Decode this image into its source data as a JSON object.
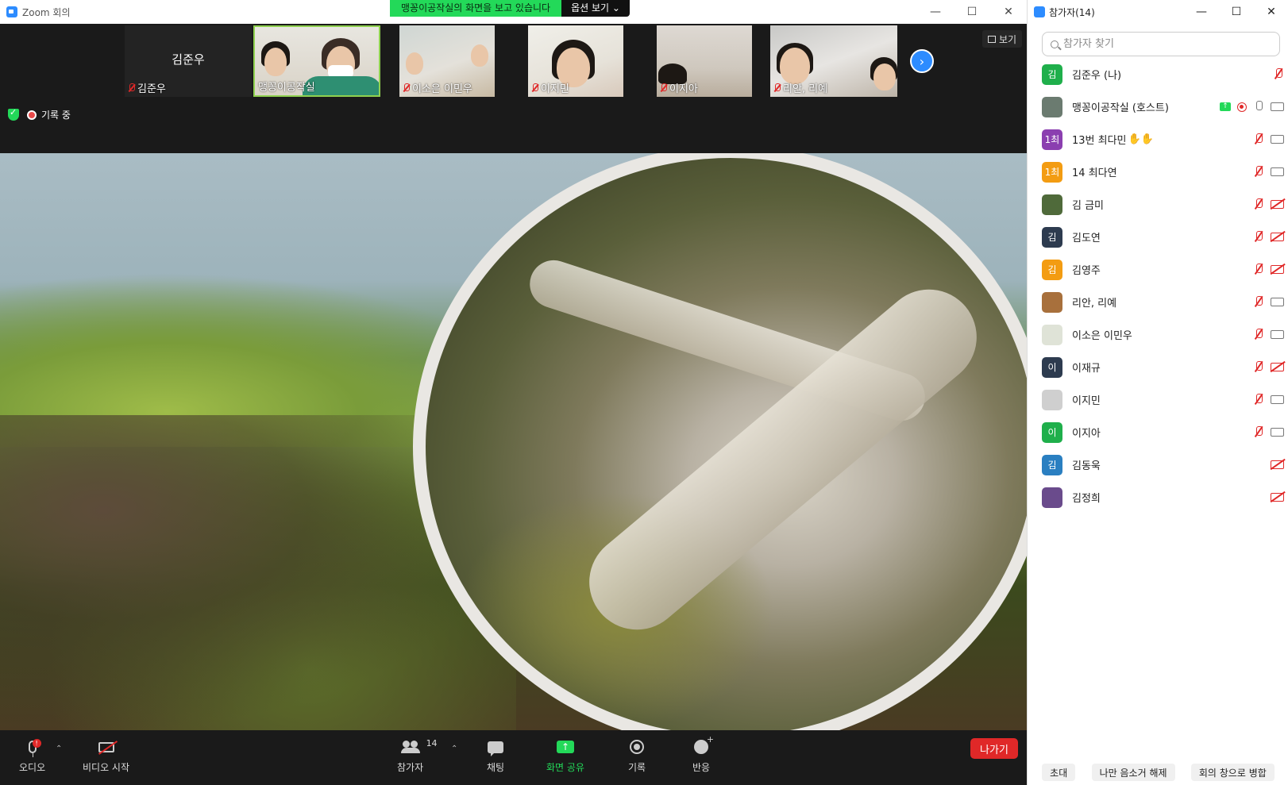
{
  "window": {
    "title": "Zoom 회의",
    "controls": [
      "—",
      "☐",
      "✕"
    ]
  },
  "share_banner": {
    "message": "맹꽁이공작실의 화면을 보고 있습니다",
    "options_label": "옵션 보기 ⌄"
  },
  "strip": {
    "view_label": "보기",
    "next_icon": "chevron-right-icon",
    "thumbnails": [
      {
        "name": "김준우",
        "big_name": "김준우",
        "muted": true,
        "video": false
      },
      {
        "name": "맹꽁이공작실",
        "muted": false,
        "video": true,
        "active_speaker": true
      },
      {
        "name": "이소은 이민우",
        "muted": true,
        "video": true
      },
      {
        "name": "이지민",
        "muted": true,
        "video": true
      },
      {
        "name": "이지아",
        "muted": true,
        "video": true
      },
      {
        "name": "리안, 리예",
        "muted": true,
        "video": true
      }
    ]
  },
  "status": {
    "encryption_icon": "shield-check-icon",
    "recording_label": "기록 중"
  },
  "toolbar": {
    "audio_label": "오디오",
    "video_label": "비디오 시작",
    "participants_label": "참가자",
    "participants_count": "14",
    "chat_label": "채팅",
    "share_label": "화면 공유",
    "record_label": "기록",
    "reactions_label": "반응",
    "leave_label": "나가기"
  },
  "panel": {
    "title": "참가자(14)",
    "controls": [
      "—",
      "☐",
      "✕"
    ],
    "search_placeholder": "참가자 찾기",
    "participants": [
      {
        "name": "김준우 (나)",
        "avatar": "김",
        "color": "#1faf4b",
        "mic": "off",
        "cam": "none"
      },
      {
        "name": "맹꽁이공작실 (호스트)",
        "avatar": "",
        "color": "#6b7b70",
        "mic": "on",
        "cam": "on",
        "sharing": true,
        "recording": true
      },
      {
        "name": "13번 최다민",
        "avatar": "1최",
        "color": "#8b3fb0",
        "mic": "off",
        "cam": "on",
        "hands": "✋✋"
      },
      {
        "name": "14 최다연",
        "avatar": "1최",
        "color": "#f39c12",
        "mic": "off",
        "cam": "on"
      },
      {
        "name": "김 금미",
        "avatar": "",
        "color": "#4f6a3a",
        "mic": "off",
        "cam": "off"
      },
      {
        "name": "김도연",
        "avatar": "김",
        "color": "#2d3b4f",
        "mic": "off",
        "cam": "off"
      },
      {
        "name": "김영주",
        "avatar": "김",
        "color": "#f39c12",
        "mic": "off",
        "cam": "off"
      },
      {
        "name": "리안, 리예",
        "avatar": "",
        "color": "#a8703c",
        "mic": "off",
        "cam": "on"
      },
      {
        "name": "이소은 이민우",
        "avatar": "",
        "color": "#dfe3d7",
        "mic": "off",
        "cam": "on"
      },
      {
        "name": "이재규",
        "avatar": "이",
        "color": "#2d3b4f",
        "mic": "off",
        "cam": "off"
      },
      {
        "name": "이지민",
        "avatar": "",
        "color": "#cfcfcf",
        "mic": "off",
        "cam": "on"
      },
      {
        "name": "이지아",
        "avatar": "이",
        "color": "#1faf4b",
        "mic": "off",
        "cam": "on"
      },
      {
        "name": "김동욱",
        "avatar": "김",
        "color": "#2a7fc1",
        "mic": "none",
        "cam": "off"
      },
      {
        "name": "김정희",
        "avatar": "",
        "color": "#6a4b8c",
        "mic": "none",
        "cam": "off"
      }
    ],
    "footer": {
      "invite_label": "초대",
      "unmute_me_label": "나만 음소거 해제",
      "merge_label": "회의 창으로 병합"
    }
  }
}
